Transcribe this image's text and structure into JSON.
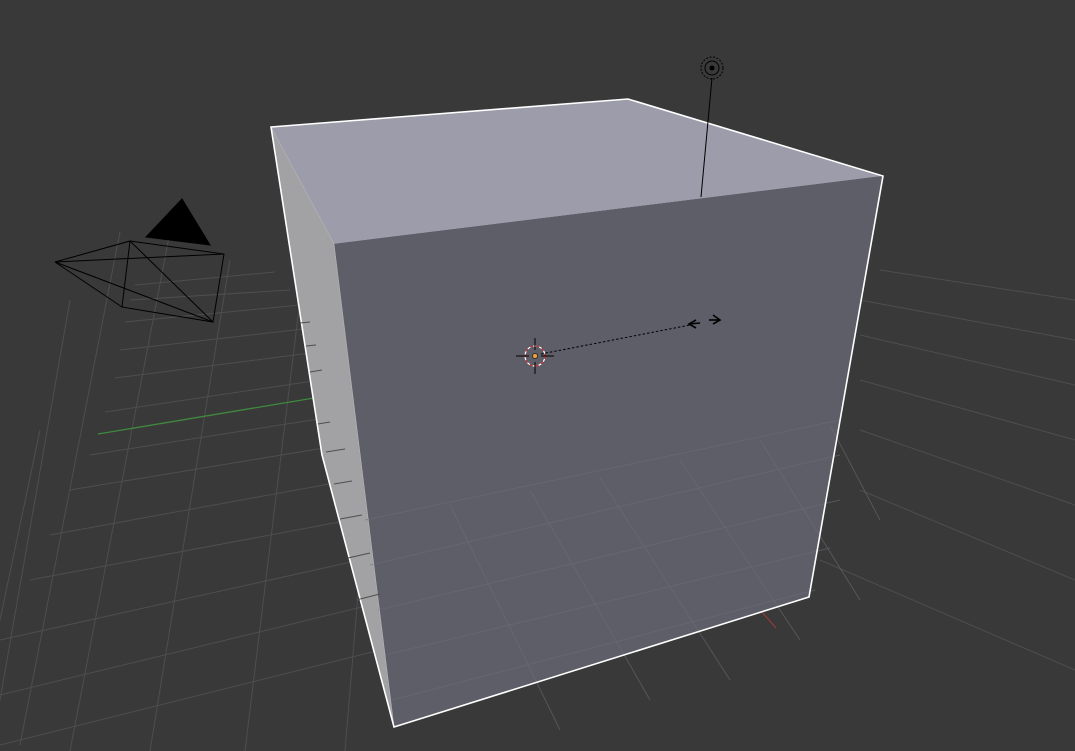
{
  "app": "3D Viewport",
  "scene": {
    "objects": [
      {
        "name": "cube",
        "type": "mesh",
        "selected": true
      },
      {
        "name": "camera",
        "type": "camera",
        "selected": false
      },
      {
        "name": "lamp",
        "type": "lamp",
        "selected": false
      },
      {
        "name": "3d-cursor",
        "type": "cursor"
      }
    ],
    "colors": {
      "background": "#393939",
      "grid": "#4e4e4e",
      "x_axis": "#8f3a3a",
      "y_axis": "#3e8a3e",
      "cube_top": "#9c9cab",
      "cube_front": "#5e5e69",
      "cube_side": "#a2a2a4",
      "selection_outline": "#ffffff",
      "wire": "#000000"
    }
  }
}
